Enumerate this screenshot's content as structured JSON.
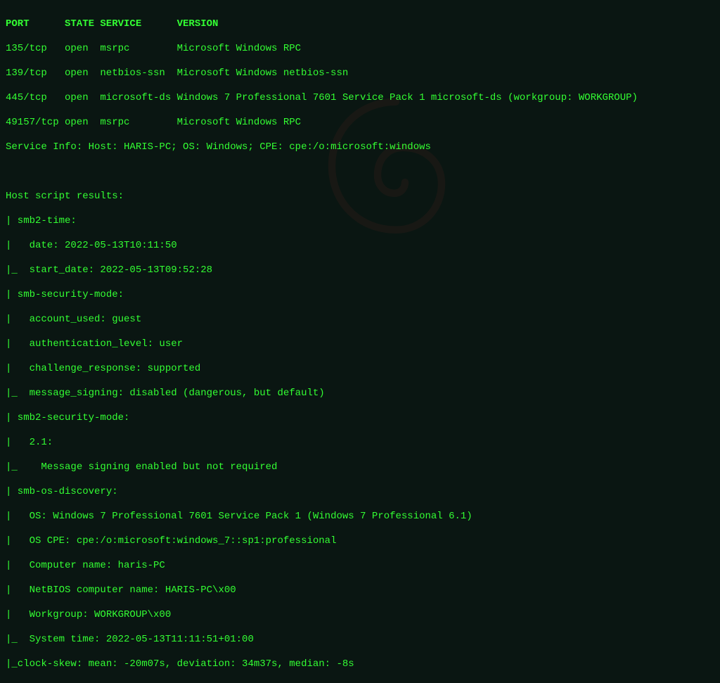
{
  "header": {
    "port": "PORT",
    "state": "STATE",
    "service": "SERVICE",
    "version": "VERSION"
  },
  "ports": [
    {
      "port": "135/tcp",
      "state": "open",
      "service": "msrpc",
      "version": "Microsoft Windows RPC"
    },
    {
      "port": "139/tcp",
      "state": "open",
      "service": "netbios-ssn",
      "version": "Microsoft Windows netbios-ssn"
    },
    {
      "port": "445/tcp",
      "state": "open",
      "service": "microsoft-ds",
      "version": "Windows 7 Professional 7601 Service Pack 1 microsoft-ds (workgroup: WORKGROUP)"
    },
    {
      "port": "49157/tcp",
      "state": "open",
      "service": "msrpc",
      "version": "Microsoft Windows RPC"
    }
  ],
  "service_info": "Service Info: Host: HARIS-PC; OS: Windows; CPE: cpe:/o:microsoft:windows",
  "host_results_header": "Host script results:",
  "scripts": {
    "smb2_time": {
      "name": "| smb2-time:",
      "date": "|   date: 2022-05-13T10:11:50",
      "start_date": "|_  start_date: 2022-05-13T09:52:28"
    },
    "smb_security_mode": {
      "name": "| smb-security-mode:",
      "account_used": "|   account_used: guest",
      "authentication_level": "|   authentication_level: user",
      "challenge_response": "|   challenge_response: supported",
      "message_signing": "|_  message_signing: disabled (dangerous, but default)"
    },
    "smb2_security_mode": {
      "name": "| smb2-security-mode:",
      "version": "|   2.1:",
      "message": "|_    Message signing enabled but not required"
    },
    "smb_os_discovery": {
      "name": "| smb-os-discovery:",
      "os": "|   OS: Windows 7 Professional 7601 Service Pack 1 (Windows 7 Professional 6.1)",
      "os_cpe": "|   OS CPE: cpe:/o:microsoft:windows_7::sp1:professional",
      "computer_name": "|   Computer name: haris-PC",
      "netbios_name": "|   NetBIOS computer name: HARIS-PC\\x00",
      "workgroup": "|   Workgroup: WORKGROUP\\x00",
      "system_time": "|_  System time: 2022-05-13T11:11:51+01:00"
    },
    "clock_skew": "|_clock-skew: mean: -20m07s, deviation: 34m37s, median: -8s"
  }
}
